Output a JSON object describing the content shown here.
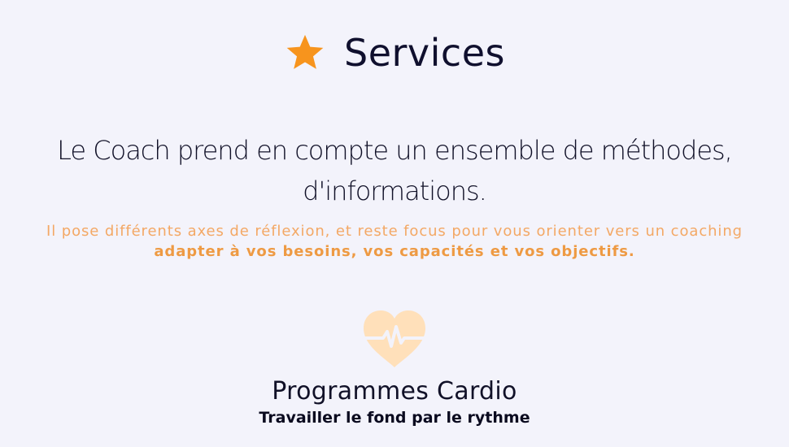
{
  "header": {
    "icon": "star-icon",
    "title": "Services"
  },
  "intro": {
    "line1": "Le Coach prend en compte un ensemble de méthodes,",
    "line2": "d'informations."
  },
  "subtitle": {
    "line1": "Il pose différents axes de réflexion, et reste focus pour vous orienter vers un coaching",
    "line2": "adapter à vos besoins, vos capacités et vos objectifs."
  },
  "service": {
    "icon": "heart-pulse-icon",
    "title": "Programmes Cardio",
    "description": "Travailler le fond par le rythme"
  },
  "colors": {
    "accent": "#f7941d",
    "text": "#111128",
    "subtitle": "#f3a865",
    "heart": "#ffe0ba",
    "background": "#f3f3fb"
  }
}
